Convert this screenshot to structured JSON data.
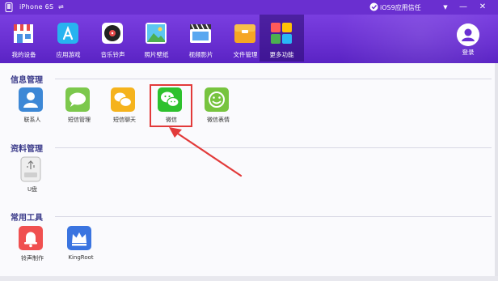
{
  "titlebar": {
    "device_name": "iPhone  6S",
    "usb_glyph": "⇌",
    "trust_label": "iOS9应用信任",
    "menu_glyph": "▼",
    "minimize_glyph": "—",
    "close_glyph": "✕",
    "icons": [
      "device-icon",
      "usb-icon",
      "trust-icon"
    ]
  },
  "toolbar": {
    "tabs": [
      {
        "label": "我的设备",
        "icon": "shop-icon",
        "active": false
      },
      {
        "label": "应用游戏",
        "icon": "app-store-icon",
        "active": false
      },
      {
        "label": "音乐铃声",
        "icon": "music-icon",
        "active": false
      },
      {
        "label": "照片壁纸",
        "icon": "photo-icon",
        "active": false
      },
      {
        "label": "视频影片",
        "icon": "video-icon",
        "active": false
      },
      {
        "label": "文件管理",
        "icon": "folder-icon",
        "active": false
      },
      {
        "label": "更多功能",
        "icon": "more-icon",
        "active": true
      }
    ],
    "login_label": "登录"
  },
  "sections": [
    {
      "title": "信息管理",
      "items": [
        {
          "label": "联系人",
          "icon": "contacts-icon",
          "color": "#3d88d6"
        },
        {
          "label": "短信管理",
          "icon": "sms-icon",
          "color": "#7cc84c"
        },
        {
          "label": "短信聊天",
          "icon": "chat-icon",
          "color": "#f5b31d"
        },
        {
          "label": "微信",
          "icon": "wechat-icon",
          "color": "#2dc12d"
        },
        {
          "label": "微信表情",
          "icon": "wechat-emoji-icon",
          "color": "#77c43f"
        }
      ]
    },
    {
      "title": "资料管理",
      "items": [
        {
          "label": "U盘",
          "icon": "usb-drive-icon",
          "color": "#e8e8e8"
        }
      ]
    },
    {
      "title": "常用工具",
      "items": [
        {
          "label": "铃声制作",
          "icon": "ringtone-icon",
          "color": "#f05050"
        },
        {
          "label": "KingRoot",
          "icon": "kingroot-icon",
          "color": "#3a74e0"
        }
      ]
    }
  ],
  "colors": {
    "accent": "#6a30d2",
    "highlight": "#e23a3a"
  }
}
